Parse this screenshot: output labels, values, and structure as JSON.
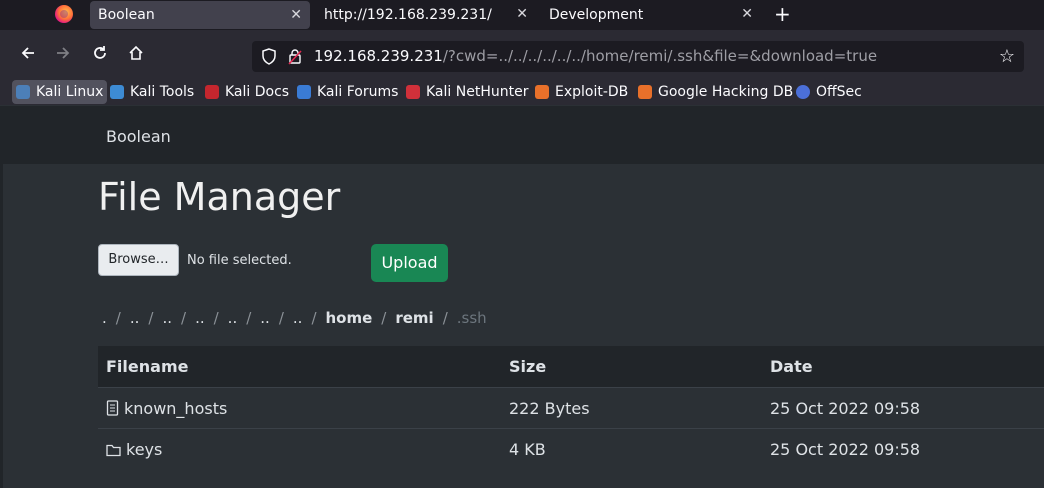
{
  "browser": {
    "tabs": [
      {
        "label": "Boolean",
        "active": true
      },
      {
        "label": "http://192.168.239.231/",
        "active": false
      },
      {
        "label": "Development",
        "active": false
      }
    ],
    "new_tab_label": "+",
    "close_label": "✕",
    "url_host": "192.168.239.231",
    "url_rest": "/?cwd=../../../../../../home/remi/.ssh&file=&download=true",
    "bookmarks": [
      {
        "label": "Kali Linux",
        "color": "#4c7fb8"
      },
      {
        "label": "Kali Tools",
        "color": "#3d8bd4"
      },
      {
        "label": "Kali Docs",
        "color": "#c4262e"
      },
      {
        "label": "Kali Forums",
        "color": "#3a7bd5"
      },
      {
        "label": "Kali NetHunter",
        "color": "#d0303a"
      },
      {
        "label": "Exploit-DB",
        "color": "#e8702a"
      },
      {
        "label": "Google Hacking DB",
        "color": "#e8702a"
      },
      {
        "label": "OffSec",
        "color": "#4b6fd8"
      }
    ]
  },
  "app": {
    "brand": "Boolean",
    "title": "File Manager",
    "browse_label": "Browse…",
    "no_file_label": "No file selected.",
    "upload_label": "Upload",
    "breadcrumb": [
      ".",
      "..",
      "..",
      "..",
      "..",
      "..",
      "..",
      "home",
      "remi",
      ".ssh"
    ],
    "table": {
      "headers": [
        "Filename",
        "Size",
        "Date"
      ],
      "rows": [
        {
          "icon": "file-icon",
          "name": "known_hosts",
          "size": "222 Bytes",
          "date": "25 Oct 2022 09:58"
        },
        {
          "icon": "folder-icon",
          "name": "keys",
          "size": "4 KB",
          "date": "25 Oct 2022 09:58"
        }
      ]
    }
  }
}
